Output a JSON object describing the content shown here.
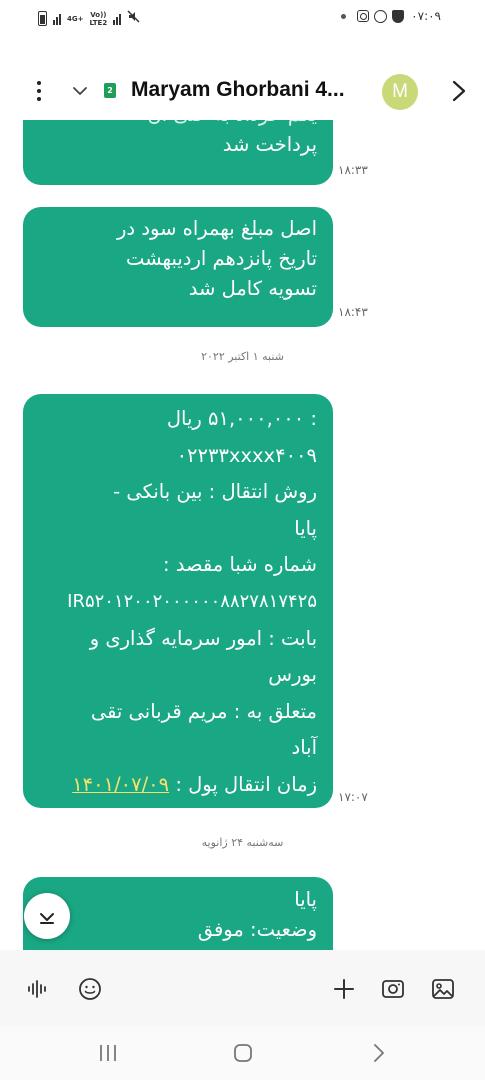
{
  "status_bar": {
    "network_top": "4G+",
    "network_volte": "Vo))",
    "network_lte": "LTE2",
    "clock": "۰۷:۰۹"
  },
  "header": {
    "sim_number": "2",
    "contact_name": "Maryam Ghorbani 4...",
    "avatar_initial": "M"
  },
  "messages": [
    {
      "lines": [
        "پرداخت شد"
      ],
      "partial_top_line": "یکم حرداد به علی آن",
      "time": "۱۸:۳۳"
    },
    {
      "lines": [
        "اصل مبلغ بهمراه سود در",
        "تاریخ پانزدهم اردیبهشت",
        "تسویه کامل شد"
      ],
      "time": "۱۸:۴۳"
    },
    {
      "date_separator": "شنبه ۱ اکتبر ۲۰۲۲"
    },
    {
      "lines": [
        ": ۵۱,۰۰۰,۰۰۰ ریال",
        "۰۲۲۳۳xxxx۴۰۰۹",
        "روش انتقال : بین بانکی -",
        "پایا",
        "شماره شبا مقصد :",
        "IR۵۲۰۱۲۰۰۲۰۰۰۰۰۰۸۸۲۷۸۱۷۴۲۵",
        "بابت : امور سرمایه گذاری و",
        "بورس",
        "متعلق به : مریم قربانی تقی",
        "آباد"
      ],
      "last_line_prefix": "زمان انتقال پول : ",
      "last_line_link": "۱۴۰۱/۰۷/۰۹",
      "time": "۱۷:۰۷"
    },
    {
      "date_separator": "سه‌شنبه ۲۴ ژانویه"
    },
    {
      "lines": [
        "پایا",
        "وضعیت: موفق"
      ]
    }
  ],
  "colors": {
    "bubble": "#1aa784",
    "link": "#f5e26a",
    "avatar": "#c9d977",
    "sim_badge": "#1e9e59"
  },
  "icons": {
    "composer": [
      "voice-icon",
      "emoji-icon",
      "plus-icon",
      "camera-icon",
      "gallery-icon"
    ],
    "nav": [
      "recents-icon",
      "home-icon",
      "back-icon"
    ]
  }
}
